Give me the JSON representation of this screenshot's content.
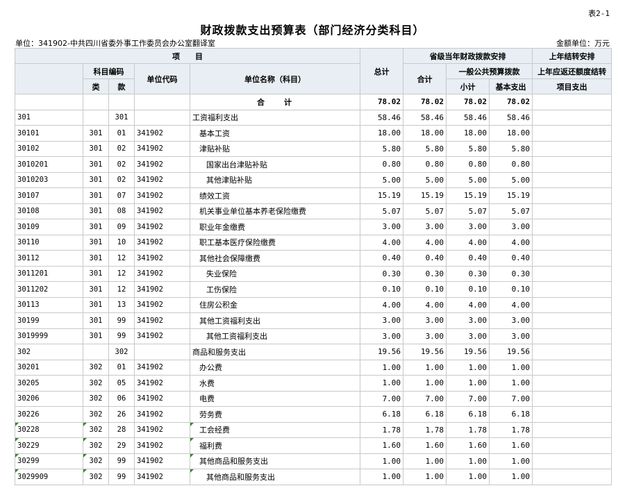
{
  "table_no": "表2-1",
  "title": "财政拨款支出预算表（部门经济分类科目）",
  "unit_line": "单位：341902-中共四川省委外事工作委员会办公室翻译室",
  "amount_unit": "金额单位：万元",
  "headers": {
    "item": "项　　目",
    "subject_code": "科目编码",
    "category": "类",
    "section": "款",
    "unit_code": "单位代码",
    "unit_name": "单位名称（科目）",
    "total": "总计",
    "provincial": "省级当年财政拨款安排",
    "carryover": "上年结转安排",
    "subtotal": "合计",
    "general_public": "一般公共预算拨款",
    "repay_carryover": "上年应返还额度结转",
    "small_total": "小计",
    "basic_expense": "基本支出",
    "project_expense": "项目支出"
  },
  "total_row": {
    "label": "合　　计",
    "total": "78.02",
    "subtotal": "78.02",
    "small_total": "78.02",
    "basic": "78.02"
  },
  "rows": [
    {
      "code": "301",
      "cat": "",
      "sec": "301",
      "unit": "",
      "name": "工资福利支出",
      "level": 0,
      "v": "58.46"
    },
    {
      "code": "30101",
      "cat": "301",
      "sec": "01",
      "unit": "341902",
      "name": "基本工资",
      "level": 1,
      "v": "18.00"
    },
    {
      "code": "30102",
      "cat": "301",
      "sec": "02",
      "unit": "341902",
      "name": "津贴补贴",
      "level": 1,
      "v": "5.80"
    },
    {
      "code": "3010201",
      "cat": "301",
      "sec": "02",
      "unit": "341902",
      "name": "国家出台津贴补贴",
      "level": 2,
      "v": "0.80"
    },
    {
      "code": "3010203",
      "cat": "301",
      "sec": "02",
      "unit": "341902",
      "name": "其他津贴补贴",
      "level": 2,
      "v": "5.00"
    },
    {
      "code": "30107",
      "cat": "301",
      "sec": "07",
      "unit": "341902",
      "name": "绩效工资",
      "level": 1,
      "v": "15.19"
    },
    {
      "code": "30108",
      "cat": "301",
      "sec": "08",
      "unit": "341902",
      "name": "机关事业单位基本养老保险缴费",
      "level": 1,
      "v": "5.07"
    },
    {
      "code": "30109",
      "cat": "301",
      "sec": "09",
      "unit": "341902",
      "name": "职业年金缴费",
      "level": 1,
      "v": "3.00"
    },
    {
      "code": "30110",
      "cat": "301",
      "sec": "10",
      "unit": "341902",
      "name": "职工基本医疗保险缴费",
      "level": 1,
      "v": "4.00"
    },
    {
      "code": "30112",
      "cat": "301",
      "sec": "12",
      "unit": "341902",
      "name": "其他社会保障缴费",
      "level": 1,
      "v": "0.40"
    },
    {
      "code": "3011201",
      "cat": "301",
      "sec": "12",
      "unit": "341902",
      "name": "失业保险",
      "level": 2,
      "v": "0.30"
    },
    {
      "code": "3011202",
      "cat": "301",
      "sec": "12",
      "unit": "341902",
      "name": "工伤保险",
      "level": 2,
      "v": "0.10"
    },
    {
      "code": "30113",
      "cat": "301",
      "sec": "13",
      "unit": "341902",
      "name": "住房公积金",
      "level": 1,
      "v": "4.00"
    },
    {
      "code": "30199",
      "cat": "301",
      "sec": "99",
      "unit": "341902",
      "name": "其他工资福利支出",
      "level": 1,
      "v": "3.00"
    },
    {
      "code": "3019999",
      "cat": "301",
      "sec": "99",
      "unit": "341902",
      "name": "其他工资福利支出",
      "level": 2,
      "v": "3.00"
    },
    {
      "code": "302",
      "cat": "",
      "sec": "302",
      "unit": "",
      "name": "商品和服务支出",
      "level": 0,
      "v": "19.56"
    },
    {
      "code": "30201",
      "cat": "302",
      "sec": "01",
      "unit": "341902",
      "name": "办公费",
      "level": 1,
      "v": "1.00"
    },
    {
      "code": "30205",
      "cat": "302",
      "sec": "05",
      "unit": "341902",
      "name": "水费",
      "level": 1,
      "v": "1.00"
    },
    {
      "code": "30206",
      "cat": "302",
      "sec": "06",
      "unit": "341902",
      "name": "电费",
      "level": 1,
      "v": "7.00"
    },
    {
      "code": "30226",
      "cat": "302",
      "sec": "26",
      "unit": "341902",
      "name": "劳务费",
      "level": 1,
      "v": "6.18"
    },
    {
      "code": "30228",
      "cat": "302",
      "sec": "28",
      "unit": "341902",
      "name": "工会经费",
      "level": 1,
      "v": "1.78",
      "marked": true
    },
    {
      "code": "30229",
      "cat": "302",
      "sec": "29",
      "unit": "341902",
      "name": "福利费",
      "level": 1,
      "v": "1.60",
      "marked": true
    },
    {
      "code": "30299",
      "cat": "302",
      "sec": "99",
      "unit": "341902",
      "name": "其他商品和服务支出",
      "level": 1,
      "v": "1.00",
      "marked": true
    },
    {
      "code": "3029909",
      "cat": "302",
      "sec": "99",
      "unit": "341902",
      "name": "其他商品和服务支出",
      "level": 2,
      "v": "1.00",
      "marked": true
    }
  ]
}
